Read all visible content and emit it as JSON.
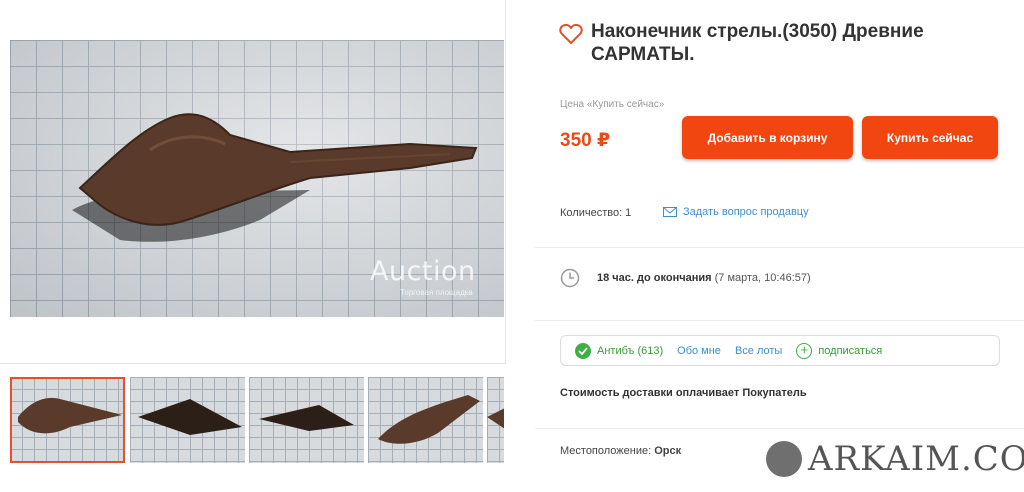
{
  "gallery": {
    "watermark": "Auction",
    "watermark_sub": "Торговая площадка",
    "thumbnail_count": 5
  },
  "lot": {
    "title": "Наконечник стрелы.(3050) Древние САРМАТЫ.",
    "price_label": "Цена «Купить сейчас»",
    "price": "350 ₽",
    "add_to_cart_label": "Добавить в корзину",
    "buy_now_label": "Купить сейчас",
    "quantity_text": "Количество: 1",
    "ask_seller_label": "Задать вопрос продавцу",
    "time_left": "18 час. до окончания",
    "end_date": "(7 марта, 10:46:57)"
  },
  "seller": {
    "name": "Антибъ (613)",
    "about_label": "Обо мне",
    "all_lots_label": "Все лоты",
    "subscribe_label": "подписаться"
  },
  "shipping": {
    "delivery_note": "Стоимость доставки оплачивает Покупатель",
    "location_label": "Местоположение:",
    "location_value": "Орск"
  },
  "brand": {
    "name": "ARKAIM.CO"
  },
  "colors": {
    "accent": "#f24611",
    "price": "#e94b18",
    "link": "#3e8ed0",
    "success": "#3cb043"
  }
}
